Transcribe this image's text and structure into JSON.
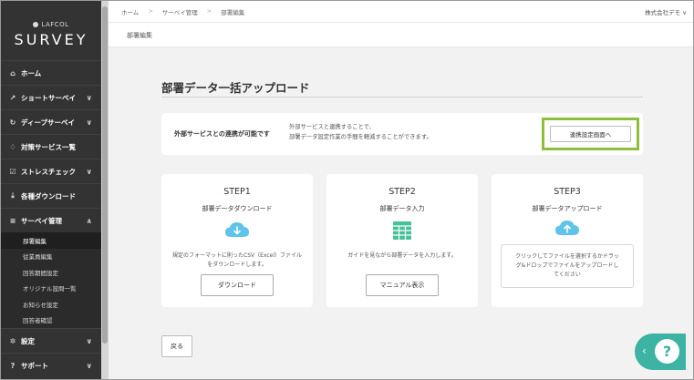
{
  "logo": {
    "brand_small": "LAFCOL",
    "brand_main": "SURVEY"
  },
  "sidebar": {
    "items": [
      {
        "icon": "home-icon",
        "label": "ホーム",
        "glyph": "⌂"
      },
      {
        "icon": "chart-icon",
        "label": "ショートサーベイ",
        "glyph": "↗",
        "chevron": "∨"
      },
      {
        "icon": "refresh-icon",
        "label": "ディープサーベイ",
        "glyph": "↻",
        "chevron": "∨"
      },
      {
        "icon": "lightbulb-icon",
        "label": "対策サービス一覧",
        "glyph": "♢"
      },
      {
        "icon": "checkbox-icon",
        "label": "ストレスチェック",
        "glyph": "☑",
        "chevron": "∨"
      },
      {
        "icon": "download-icon",
        "label": "各種ダウンロード",
        "glyph": "⤓"
      },
      {
        "icon": "list-icon",
        "label": "サーベイ管理",
        "glyph": "≡",
        "chevron": "∧"
      }
    ],
    "sub_items": [
      {
        "label": "部署編集",
        "active": true
      },
      {
        "label": "従業員編集"
      },
      {
        "label": "回答期間設定"
      },
      {
        "label": "オリジナル設問一覧"
      },
      {
        "label": "お知らせ設定"
      },
      {
        "label": "回答者確認"
      }
    ],
    "bottom_items": [
      {
        "icon": "gear-icon",
        "label": "設定",
        "glyph": "✲",
        "chevron": "∨"
      },
      {
        "icon": "question-icon",
        "label": "サポート",
        "glyph": "?",
        "chevron": "∨"
      }
    ]
  },
  "breadcrumb": [
    "ホーム",
    "サーベイ管理",
    "部署編集"
  ],
  "breadcrumb_sep": ">",
  "company": "株式会社デモ ∨",
  "subheader": "部署編集",
  "page_title": "部署データ一括アップロード",
  "external": {
    "title": "外部サービスとの連携が可能です",
    "desc_line1": "外部サービスと連携することで、",
    "desc_line2": "部署データ設定作業の手間を軽減することができます。",
    "button": "連携設定画面へ",
    "highlight_color": "#8dbf3a"
  },
  "steps": [
    {
      "label": "STEP1",
      "title": "部署データダウンロード",
      "icon": "cloud-download-icon",
      "desc_line1": "規定のフォーマットに則ったCSV（Excel）ファイル",
      "desc_line2": "をダウンロードします。",
      "button": "ダウンロード"
    },
    {
      "label": "STEP2",
      "title": "部署データ入力",
      "icon": "spreadsheet-icon",
      "desc_line1": "ガイドを見ながら部署データを入力します。",
      "button": "マニュアル表示"
    },
    {
      "label": "STEP3",
      "title": "部署データアップロード",
      "icon": "cloud-upload-icon",
      "drop_line1": "クリックしてファイルを選択するかドラッ",
      "drop_line2": "グ&ドロップでファイルをアップロードし",
      "drop_line3": "てください"
    }
  ],
  "back_button": "戻る",
  "help": {
    "chevron": "‹",
    "glyph": "?",
    "color": "#3db3a4"
  },
  "colors": {
    "sidebar": "#333333",
    "content_bg": "#f2f2f2",
    "accent_icon": "#3db3a4"
  }
}
